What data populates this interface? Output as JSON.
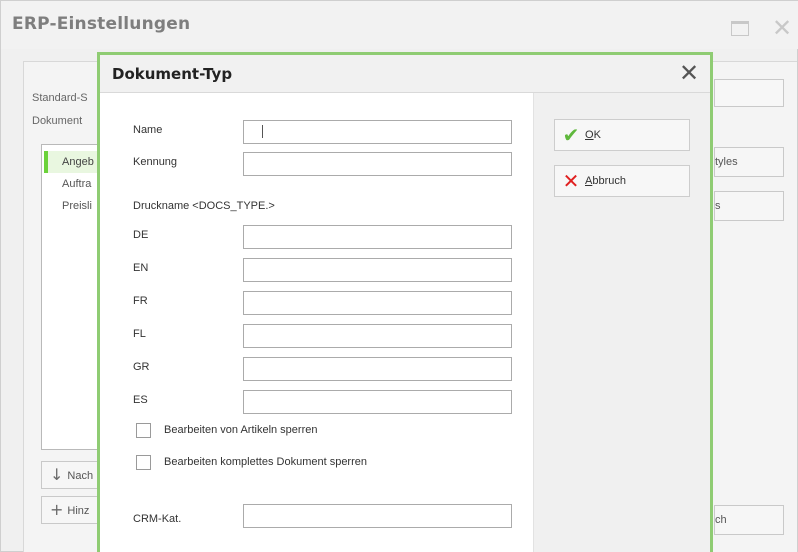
{
  "window": {
    "title": "ERP-Einstellungen",
    "maximize_icon": "maximize-icon",
    "close_icon": "close-icon"
  },
  "background": {
    "labels": {
      "standard": "Standard-S",
      "dokument": "Dokument"
    },
    "list_items": [
      "Angeb",
      "Auftra",
      "Preisli"
    ],
    "buttons": {
      "styles": "tyles",
      "s_button": "s",
      "nach": "Nach",
      "hinzu": "Hinz",
      "ch": "ch"
    },
    "icons": {
      "down_arrow": "↓",
      "plus": "+"
    }
  },
  "dialog": {
    "title": "Dokument-Typ",
    "close_glyph": "✕",
    "fields": {
      "name_label": "Name",
      "name_value": "",
      "kennung_label": "Kennung",
      "kennung_value": "",
      "druckname_heading": "Druckname <DOCS_TYPE.>",
      "languages": [
        {
          "label": "DE",
          "value": ""
        },
        {
          "label": "EN",
          "value": ""
        },
        {
          "label": "FR",
          "value": ""
        },
        {
          "label": "FL",
          "value": ""
        },
        {
          "label": "GR",
          "value": ""
        },
        {
          "label": "ES",
          "value": ""
        }
      ],
      "crm_label": "CRM-Kat.",
      "crm_value": ""
    },
    "checkboxes": [
      {
        "label": "Bearbeiten von Artikeln sperren",
        "checked": false
      },
      {
        "label": "Bearbeiten komplettes Dokument sperren",
        "checked": false
      }
    ],
    "actions": {
      "ok_mnemonic": "O",
      "ok_rest": "K",
      "ok_icon": "✔",
      "ok_color": "#5fb83c",
      "cancel_mnemonic": "A",
      "cancel_rest": "bbruch",
      "cancel_icon": "✕",
      "cancel_color": "#e02020"
    },
    "accent_color": "#8fcc73"
  }
}
